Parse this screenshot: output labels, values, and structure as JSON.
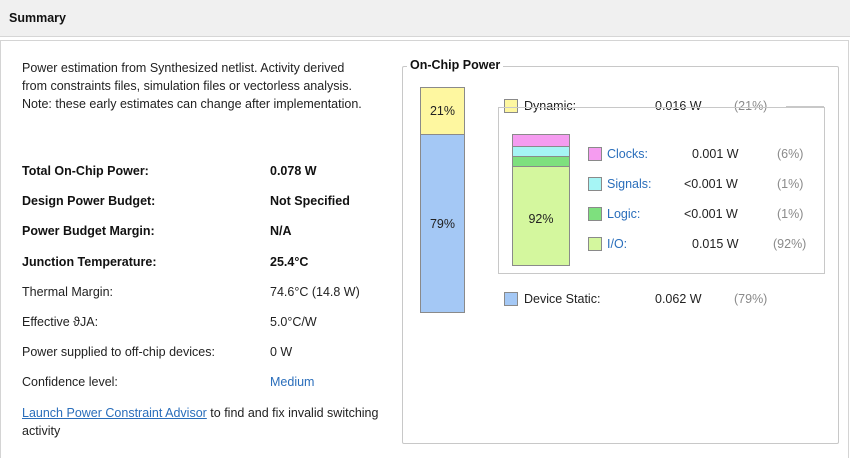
{
  "header": {
    "title": "Summary"
  },
  "intro": "Power estimation from Synthesized netlist. Activity derived from constraints files, simulation files or vectorless analysis. Note: these early estimates can change after implementation.",
  "rows": [
    {
      "label": "Total On-Chip Power:",
      "value": "0.078 W"
    },
    {
      "label": "Design Power Budget:",
      "value": "Not Specified"
    },
    {
      "label": "Power Budget Margin:",
      "value": "N/A"
    },
    {
      "label": "Junction Temperature:",
      "value": "25.4°C"
    },
    {
      "label": "Thermal Margin:",
      "value": "74.6°C (14.8 W)"
    },
    {
      "label": "Effective ϑJA:",
      "value": "5.0°C/W"
    },
    {
      "label": "Power supplied to off-chip devices:",
      "value": "0 W"
    },
    {
      "label": "Confidence level:",
      "value": "Medium"
    }
  ],
  "advisor": {
    "link": "Launch Power Constraint Advisor",
    "rest": " to find and fix invalid switching activity"
  },
  "chip": {
    "title": "On-Chip Power",
    "bar": {
      "dynamic_pct": "21%",
      "static_pct": "79%",
      "dynamic_fraction": 0.21
    },
    "dynamic": {
      "label": "Dynamic:",
      "value": "0.016 W",
      "pct": "(21%)"
    },
    "static": {
      "label": "Device Static:",
      "value": "0.062 W",
      "pct": "(79%)"
    },
    "dyn_bar_label": "92%",
    "breakdown": [
      {
        "label": "Clocks:",
        "value": "0.001 W",
        "pct": "(6%)",
        "color": "#f59cf0"
      },
      {
        "label": "Signals:",
        "value": "<0.001 W",
        "pct": "(1%)",
        "color": "#a6f5f5"
      },
      {
        "label": "Logic:",
        "value": "<0.001 W",
        "pct": "(1%)",
        "color": "#7ee07e"
      },
      {
        "label": "I/O:",
        "value": "0.015 W",
        "pct": "(92%)",
        "color": "#d4f79e"
      }
    ],
    "colors": {
      "dynamic": "#fef7a0",
      "static": "#a4c8f5",
      "link": "#2a6ebb"
    }
  }
}
